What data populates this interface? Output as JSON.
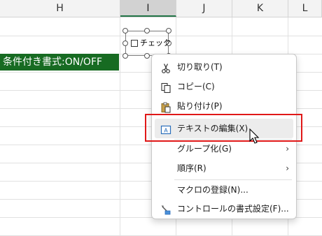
{
  "columns": [
    "H",
    "I",
    "J",
    "K",
    "L"
  ],
  "selected_column": "I",
  "cell_text": "条件付き書式:ON/OFF",
  "checkbox": {
    "label": "チェック"
  },
  "context_menu": {
    "items": [
      {
        "label": "切り取り(T)",
        "icon": "scissors-icon"
      },
      {
        "label": "コピー(C)",
        "icon": "copy-icon"
      },
      {
        "label": "貼り付け(P)",
        "icon": "paste-icon"
      },
      {
        "label": "テキストの編集(X)",
        "icon": "edit-text-icon"
      },
      {
        "label": "グループ化(G)",
        "submenu_arrow": "›"
      },
      {
        "label": "順序(R)",
        "submenu_arrow": "›"
      },
      {
        "label": "マクロの登録(N)..."
      },
      {
        "label": "コントロールの書式設定(F)...",
        "icon": "format-control-icon"
      }
    ]
  },
  "colors": {
    "cell_fill": "#176b22",
    "highlight_border": "#e01818",
    "selection_accent": "#217346"
  }
}
